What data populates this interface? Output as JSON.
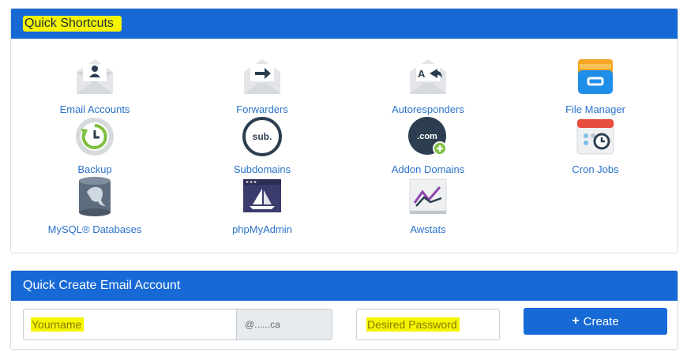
{
  "shortcuts_panel": {
    "title": "Quick Shortcuts",
    "items": [
      {
        "label": "Email Accounts",
        "icon": "email-accounts-icon"
      },
      {
        "label": "Forwarders",
        "icon": "forwarders-icon"
      },
      {
        "label": "Autoresponders",
        "icon": "autoresponders-icon"
      },
      {
        "label": "File Manager",
        "icon": "file-manager-icon"
      },
      {
        "label": "Backup",
        "icon": "backup-icon"
      },
      {
        "label": "Subdomains",
        "icon": "subdomains-icon"
      },
      {
        "label": "Addon Domains",
        "icon": "addon-domains-icon"
      },
      {
        "label": "Cron Jobs",
        "icon": "cron-jobs-icon"
      },
      {
        "label": "MySQL® Databases",
        "icon": "mysql-databases-icon"
      },
      {
        "label": "phpMyAdmin",
        "icon": "phpmyadmin-icon"
      },
      {
        "label": "Awstats",
        "icon": "awstats-icon"
      }
    ]
  },
  "create_email_panel": {
    "title": "Quick Create Email Account",
    "username_placeholder": "Yourname",
    "domain_suffix": "@......ca",
    "password_placeholder": "Desired Password",
    "create_button": "Create"
  },
  "colors": {
    "header_blue": "#176ad6",
    "highlight": "#f5f500",
    "link_blue": "#2a72c9"
  }
}
